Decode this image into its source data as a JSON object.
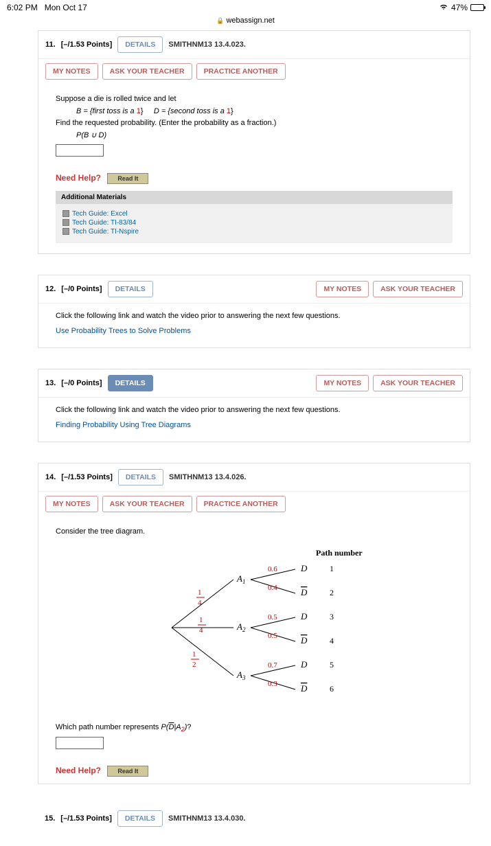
{
  "status": {
    "time": "6:02 PM",
    "date": "Mon Oct 17",
    "battery": "47%"
  },
  "url": "webassign.net",
  "q11": {
    "num": "11.",
    "points": "[–/1.53 Points]",
    "details": "DETAILS",
    "ref": "SMITHNM13 13.4.023.",
    "mynotes": "MY NOTES",
    "ask": "ASK YOUR TEACHER",
    "practice": "PRACTICE ANOTHER",
    "p1": "Suppose a die is rolled twice and let",
    "bdef_pre": "B = {first toss is a ",
    "bdef_post": "}",
    "ddef_pre": "D = {second toss is a ",
    "ddef_post": "}",
    "one": "1",
    "p2": "Find the requested probability. (Enter the probability as a fraction.)",
    "prob": "P(B ∪ D)",
    "need": "Need Help?",
    "read": "Read It",
    "addmat": "Additional Materials",
    "m1": "Tech Guide: Excel",
    "m2": "Tech Guide: TI-83/84",
    "m3": "Tech Guide: TI-Nspire"
  },
  "q12": {
    "num": "12.",
    "points": "[–/0 Points]",
    "details": "DETAILS",
    "mynotes": "MY NOTES",
    "ask": "ASK YOUR TEACHER",
    "p1": "Click the following link and watch the video prior to answering the next few questions.",
    "link": "Use Probability Trees to Solve Problems"
  },
  "q13": {
    "num": "13.",
    "points": "[–/0 Points]",
    "details": "DETAILS",
    "mynotes": "MY NOTES",
    "ask": "ASK YOUR TEACHER",
    "p1": "Click the following link and watch the video prior to answering the next few questions.",
    "link": "Finding Probability Using Tree Diagrams"
  },
  "q14": {
    "num": "14.",
    "points": "[–/1.53 Points]",
    "details": "DETAILS",
    "ref": "SMITHNM13 13.4.026.",
    "mynotes": "MY NOTES",
    "ask": "ASK YOUR TEACHER",
    "practice": "PRACTICE ANOTHER",
    "p1": "Consider the tree diagram.",
    "pathhdr": "Path number",
    "tree": {
      "br": [
        "1",
        "4",
        "1",
        "4",
        "1",
        "2"
      ],
      "A": [
        "A",
        "A",
        "A"
      ],
      "sub": [
        "1",
        "2",
        "3"
      ],
      "p": [
        "0.6",
        "0.4",
        "0.5",
        "0.5",
        "0.7",
        "0.3"
      ],
      "D": "D",
      "Db": "D",
      "paths": [
        "1",
        "2",
        "3",
        "4",
        "5",
        "6"
      ]
    },
    "subq_pre": "Which path number represents ",
    "subq_expr": "P(D̅|A₂)",
    "subq_post": "?",
    "need": "Need Help?",
    "read": "Read It"
  },
  "q15": {
    "num": "15.",
    "points": "[–/1.53 Points]",
    "details": "DETAILS",
    "ref": "SMITHNM13 13.4.030."
  }
}
